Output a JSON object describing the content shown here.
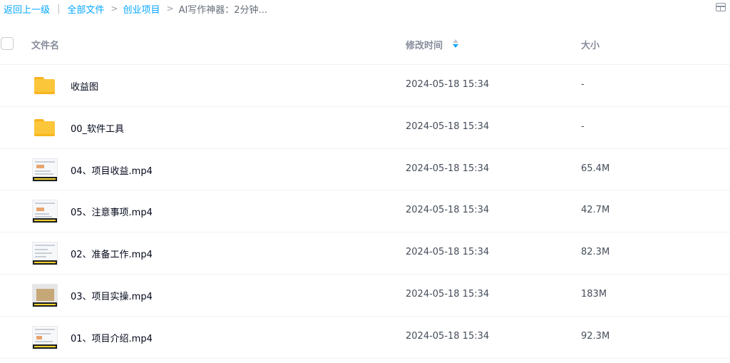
{
  "breadcrumb": {
    "back": "返回上一级",
    "separator": "|",
    "all_files": "全部文件",
    "arrow": ">",
    "folder": "创业项目",
    "current": "AI写作神器：2分钟..."
  },
  "toolbar": {
    "view_toggle_icon": "grid-view-icon"
  },
  "table": {
    "columns": {
      "name": "文件名",
      "modified": "修改时间",
      "size": "大小"
    },
    "sort": {
      "column": "modified",
      "icon": "sort-arrows-icon",
      "active_color": "#06a7ff"
    },
    "rows": [
      {
        "type": "folder",
        "icon": "folder-icon",
        "name": "收益图",
        "modified": "2024-05-18 15:34",
        "size": "-"
      },
      {
        "type": "folder",
        "icon": "folder-icon",
        "name": "00_软件工具",
        "modified": "2024-05-18 15:34",
        "size": "-"
      },
      {
        "type": "video",
        "icon": "video-thumbnail",
        "name": "04、项目收益.mp4",
        "modified": "2024-05-18 15:34",
        "size": "65.4M"
      },
      {
        "type": "video",
        "icon": "video-thumbnail",
        "name": "05、注意事项.mp4",
        "modified": "2024-05-18 15:34",
        "size": "42.7M"
      },
      {
        "type": "video",
        "icon": "video-thumbnail",
        "name": "02、准备工作.mp4",
        "modified": "2024-05-18 15:34",
        "size": "82.3M"
      },
      {
        "type": "video",
        "icon": "video-thumbnail",
        "name": "03、项目实操.mp4",
        "modified": "2024-05-18 15:34",
        "size": "183M"
      },
      {
        "type": "video",
        "icon": "video-thumbnail",
        "name": "01、项目介绍.mp4",
        "modified": "2024-05-18 15:34",
        "size": "92.3M"
      }
    ]
  },
  "colors": {
    "link": "#06a7ff",
    "folder": "#fcc63a",
    "header_text": "#878c9c",
    "text": "#03081a"
  }
}
